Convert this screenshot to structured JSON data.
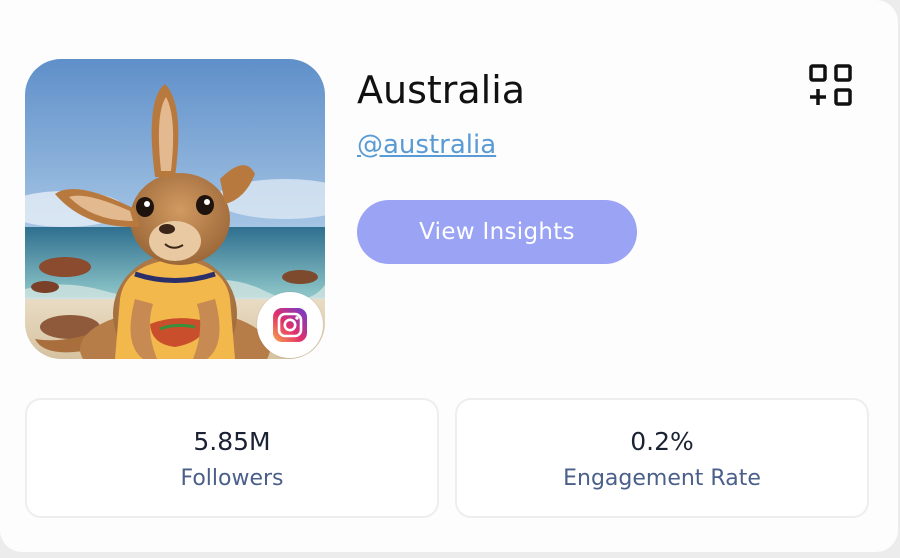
{
  "profile": {
    "name": "Australia",
    "handle": "@australia",
    "platform": "instagram-icon",
    "avatar": "kangaroo-on-beach-image"
  },
  "actions": {
    "view_insights_label": "View Insights",
    "add_widget_icon": "add-widget-icon"
  },
  "stats": [
    {
      "value": "5.85M",
      "label": "Followers"
    },
    {
      "value": "0.2%",
      "label": "Engagement Rate"
    }
  ],
  "colors": {
    "accent_button": "#9ba3f5",
    "handle_link": "#5b9bd5",
    "stat_label": "#4a5f8a"
  }
}
